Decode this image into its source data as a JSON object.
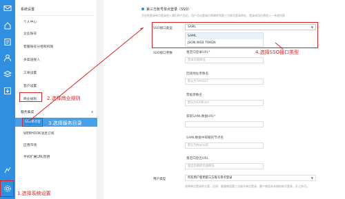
{
  "rail": {
    "icons": [
      "mail-icon",
      "home-icon",
      "book-icon",
      "user-icon",
      "layers-icon",
      "download-icon",
      "gear-icon"
    ]
  },
  "menu": {
    "title": "系统设置",
    "items": [
      "个人中心",
      "企业账号",
      "客服账号分组和权限",
      "多渠道接入",
      "工单设置",
      "客户设置",
      "商业规则"
    ],
    "group_service": "服务集成",
    "service_items": [
      "SSO单点登录",
      "WEBHOOK消息订阅",
      "应用市场",
      "手机扩展URL密钥"
    ]
  },
  "main": {
    "section_title": "第三方账号单点登录（SSO）",
    "section_desc": "开启免登录单点登录进入我们的产品后，用户点击登录后将跳转到第三方账号登录地址，登录成功后将进入一系统列表",
    "sso_type_label": "SSO接口类型",
    "sso_type_value": "SAML",
    "sso_options": [
      "SAML",
      "JSON WEB TOKEN"
    ],
    "sso_params_label": "SSO接口参数",
    "fields": [
      {
        "label": "重定向登录URL*",
        "placeholder": "登录页面网址"
      },
      {
        "label": "回调地址参数名",
        "placeholder": "默认为TARGET"
      },
      {
        "label": "票据参数名",
        "placeholder": "默认为SAMLart"
      },
      {
        "label": "获取SAML数据URL*",
        "placeholder": ""
      },
      {
        "label": "SAML数据中邮箱的节点名",
        "placeholder": "默认为NameID"
      },
      {
        "label": "重定向登出URL",
        "placeholder": "登出后跳转页面网址"
      }
    ],
    "user_type_label": "用户类型",
    "user_type_value": "所有用户使用第三方账号单点登录",
    "user_type_hint": "选择单点登录的方案，比如：客服使用第三方账号单点登录，客户使用本系统的账号登录，反之亦可。"
  },
  "annotations": {
    "step1": "1.选择系统设置",
    "step2": "2.选择商业规则",
    "step3": "3.选择服务目录",
    "step4": "4.选择SSO接口类型"
  },
  "colors": {
    "rail": "#2f8fe0",
    "annotation": "#e02020",
    "menu_selected": "#4aa0e8"
  }
}
